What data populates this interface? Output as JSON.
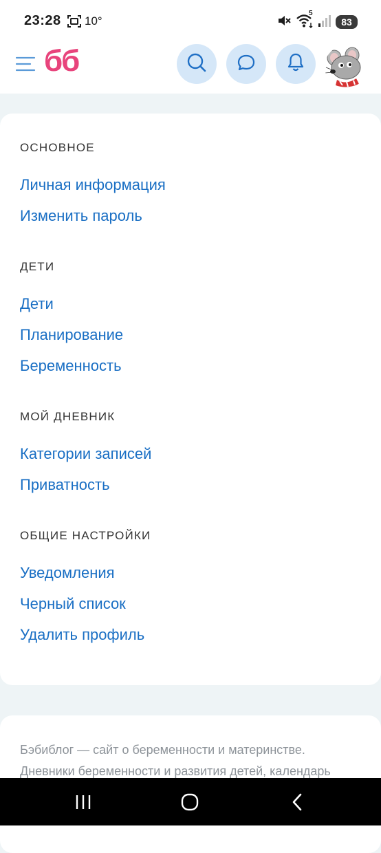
{
  "status_bar": {
    "time": "23:28",
    "temperature": "10°",
    "battery": "83",
    "wifi_label": "5",
    "icons": [
      "screen-record-icon",
      "mute-icon",
      "wifi-icon",
      "signal-icon",
      "battery-icon"
    ]
  },
  "header": {
    "logo": "бб",
    "icons": [
      "menu-icon",
      "search-icon",
      "chat-icon",
      "bell-icon",
      "avatar"
    ],
    "accent_color": "#e8447c",
    "button_bg_color": "#d5e7f8"
  },
  "sections": [
    {
      "title": "ОСНОВНОЕ",
      "links": [
        "Личная информация",
        "Изменить пароль"
      ]
    },
    {
      "title": "ДЕТИ",
      "links": [
        "Дети",
        "Планирование",
        "Беременность"
      ]
    },
    {
      "title": "МОЙ ДНЕВНИК",
      "links": [
        "Категории записей",
        "Приватность"
      ]
    },
    {
      "title": "ОБЩИЕ НАСТРОЙКИ",
      "links": [
        "Уведомления",
        "Черный список",
        "Удалить профиль"
      ]
    }
  ],
  "footer": {
    "line1": "Бэбиблог — сайт о беременности и материнстве.",
    "line2": "Дневники беременности и развития детей, календарь"
  },
  "nav_bar": {
    "icons": [
      "recent-apps-icon",
      "home-icon",
      "back-icon"
    ]
  },
  "colors": {
    "link": "#1a6fc4",
    "page_background": "#eef4f6"
  }
}
